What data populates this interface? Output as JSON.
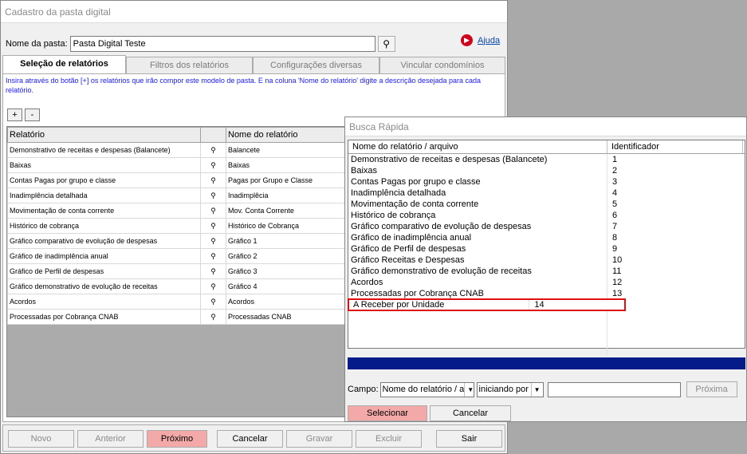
{
  "main": {
    "title": "Cadastro da pasta digital",
    "folder_label": "Nome da pasta:",
    "folder_value": "Pasta Digital Teste",
    "help_label": "Ajuda",
    "tabs": [
      "Seleção de relatórios",
      "Filtros dos relatórios",
      "Configurações diversas",
      "Vincular condomínios"
    ],
    "hint": "Insira através do botão [+] os relatórios que irão compor este modelo de pasta. E na coluna 'Nome do relatório' digite a descrição desejada para cada relatório.",
    "plus": "+",
    "minus": "-",
    "grid": {
      "headers": [
        "Relatório",
        "",
        "Nome do relatório"
      ],
      "rows": [
        [
          "Demonstrativo de receitas e despesas (Balancete)",
          "Balancete"
        ],
        [
          "Baixas",
          "Baixas"
        ],
        [
          "Contas Pagas por grupo e classe",
          "Pagas por Grupo e Classe"
        ],
        [
          "Inadimplência detalhada",
          "Inadimplêcia"
        ],
        [
          "Movimentação de conta corrente",
          "Mov. Conta Corrente"
        ],
        [
          "Histórico de cobrança",
          "Histórico de Cobrança"
        ],
        [
          "Gráfico comparativo de evolução de despesas",
          "Gráfico 1"
        ],
        [
          "Gráfico de inadimplência anual",
          "Gráfico 2"
        ],
        [
          "Gráfico de Perfil de despesas",
          "Gráfico 3"
        ],
        [
          "Gráfico demonstrativo de evolução de receitas",
          "Gráfico 4"
        ],
        [
          "Acordos",
          "Acordos"
        ],
        [
          "Processadas por Cobrança CNAB",
          "Processadas CNAB"
        ]
      ]
    },
    "buttons": [
      "Novo",
      "Anterior",
      "Próximo",
      "Cancelar",
      "Gravar",
      "Excluir",
      "Sair"
    ]
  },
  "search": {
    "title": "Busca Rápida",
    "headers": [
      "Nome do relatório / arquivo",
      "Identificador"
    ],
    "rows": [
      [
        "Demonstrativo de receitas e despesas (Balancete)",
        "1"
      ],
      [
        "Baixas",
        "2"
      ],
      [
        "Contas Pagas por grupo e classe",
        "3"
      ],
      [
        "Inadimplência detalhada",
        "4"
      ],
      [
        "Movimentação de conta corrente",
        "5"
      ],
      [
        "Histórico de cobrança",
        "6"
      ],
      [
        "Gráfico comparativo de evolução de despesas",
        "7"
      ],
      [
        "Gráfico de inadimplência anual",
        "8"
      ],
      [
        "Gráfico de Perfil de despesas",
        "9"
      ],
      [
        "Gráfico Receitas e Despesas",
        "10"
      ],
      [
        "Gráfico demonstrativo de evolução de receitas",
        "11"
      ],
      [
        "Acordos",
        "12"
      ],
      [
        "Processadas por Cobrança CNAB",
        "13"
      ],
      [
        "A Receber por Unidade",
        "14"
      ]
    ],
    "campo_label": "Campo:",
    "campo_value": "Nome do relatório / a",
    "mode_value": "iniciando por",
    "next_label": "Próxima",
    "select_label": "Selecionar",
    "cancel_label": "Cancelar"
  },
  "icons": {
    "binoculars": "binoculars-icon",
    "help": "video-help-icon"
  },
  "colors": {
    "highlight": "#f4a9a9",
    "selection_border": "#e01010",
    "hint_text": "#1a1aff",
    "scrollbar": "#051b8a"
  }
}
